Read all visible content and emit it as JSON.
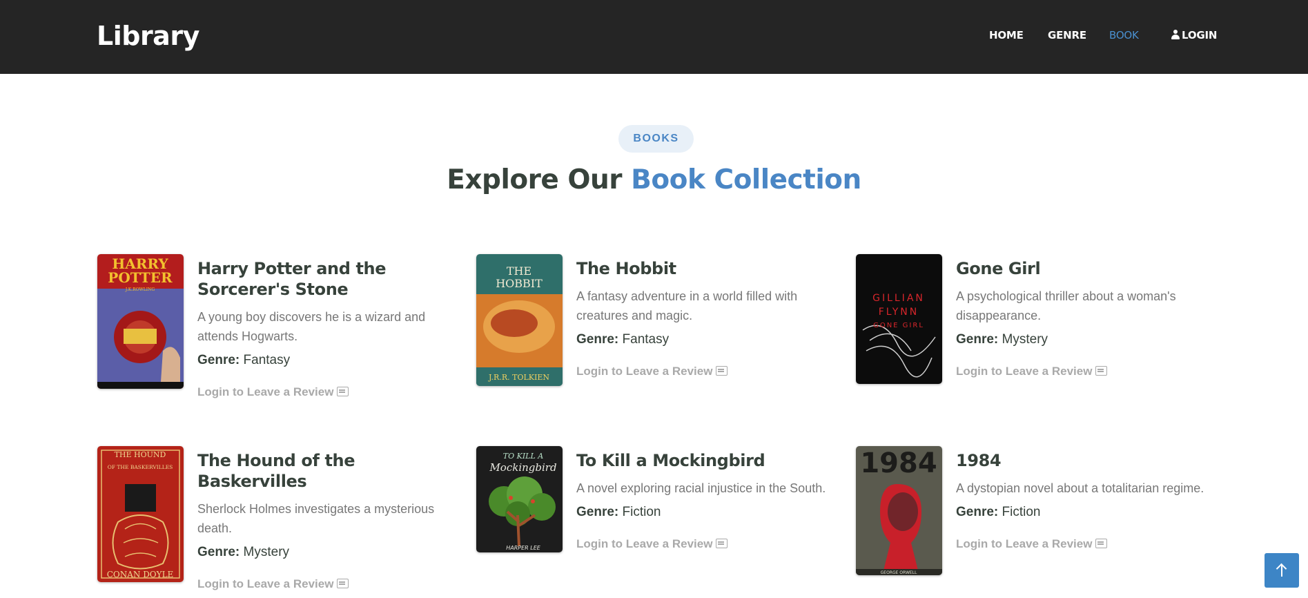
{
  "header": {
    "brand": "Library",
    "nav": [
      {
        "label": "HOME"
      },
      {
        "label": "GENRE"
      },
      {
        "label": "BOOK",
        "active": true
      },
      {
        "label": "LOGIN",
        "icon": "user-icon"
      }
    ]
  },
  "section": {
    "badge": "BOOKS",
    "heading_plain": "Explore Our ",
    "heading_accent": "Book Collection"
  },
  "genre_label": "Genre:",
  "review_label": "Login to Leave a Review",
  "books": [
    {
      "title": "Harry Potter and the Sorcerer's Stone",
      "description": "A young boy discovers he is a wizard and attends Hogwarts.",
      "genre": "Fantasy",
      "cover": {
        "top": "HARRY",
        "middle": "POTTER",
        "bottom": "J.K.ROWLING"
      }
    },
    {
      "title": "The Hobbit",
      "description": "A fantasy adventure in a world filled with creatures and magic.",
      "genre": "Fantasy",
      "cover": {
        "top": "THE",
        "middle": "HOBBIT",
        "bottom": "J.R.R. TOLKIEN"
      }
    },
    {
      "title": "Gone Girl",
      "description": "A psychological thriller about a woman's disappearance.",
      "genre": "Mystery",
      "cover": {
        "top": "GILLIAN",
        "middle": "FLYNN",
        "bottom": "GONE GIRL"
      }
    },
    {
      "title": "The Hound of the Baskervilles",
      "description": "Sherlock Holmes investigates a mysterious death.",
      "genre": "Mystery",
      "cover": {
        "top": "THE HOUND",
        "middle": "OF THE BASKERVILLES",
        "bottom": "CONAN DOYLE"
      }
    },
    {
      "title": "To Kill a Mockingbird",
      "description": "A novel exploring racial injustice in the South.",
      "genre": "Fiction",
      "cover": {
        "top": "TO KILL A",
        "middle": "Mockingbird",
        "bottom": "HARPER LEE"
      }
    },
    {
      "title": "1984",
      "description": "A dystopian novel about a totalitarian regime.",
      "genre": "Fiction",
      "cover": {
        "top": "1984",
        "middle": "",
        "bottom": "GEORGE ORWELL"
      }
    }
  ],
  "colors": {
    "accent": "#4a86c5",
    "header_bg": "#252525",
    "heading": "#37423b"
  }
}
